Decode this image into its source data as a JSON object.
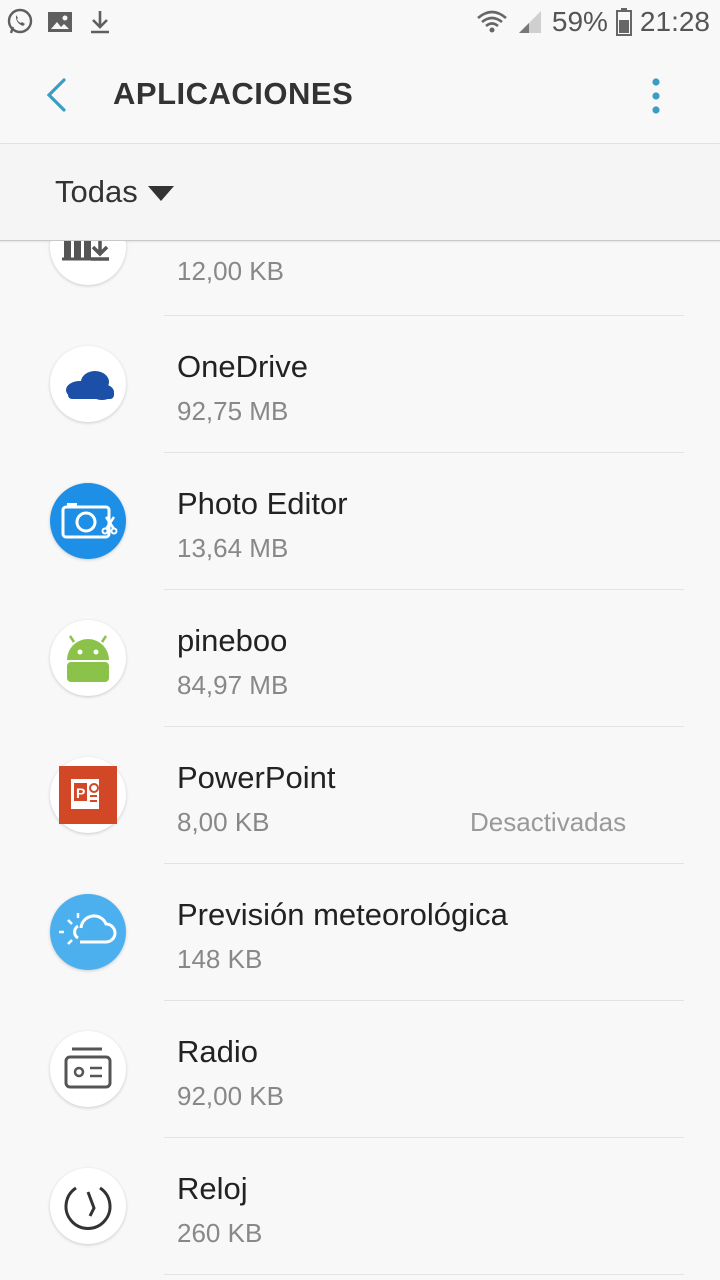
{
  "status_bar": {
    "battery_percent": "59%",
    "time": "21:28",
    "left_icons": [
      "whatsapp-icon",
      "image-icon",
      "download-icon"
    ],
    "right_icons": [
      "wifi-icon",
      "signal-icon",
      "battery-icon"
    ]
  },
  "app_bar": {
    "title": "APLICACIONES",
    "back_icon": "back-chevron-icon",
    "more_icon": "more-vert-icon",
    "accent_color": "#3b9cc4"
  },
  "filter": {
    "selected": "Todas"
  },
  "apps": [
    {
      "name": "",
      "size": "12,00 KB",
      "state": "",
      "icon": "download-manager-icon"
    },
    {
      "name": "OneDrive",
      "size": "92,75 MB",
      "state": "",
      "icon": "onedrive-icon"
    },
    {
      "name": "Photo Editor",
      "size": "13,64 MB",
      "state": "",
      "icon": "photo-editor-icon"
    },
    {
      "name": "pineboo",
      "size": "84,97 MB",
      "state": "",
      "icon": "android-icon"
    },
    {
      "name": "PowerPoint",
      "size": "8,00 KB",
      "state": "Desactivadas",
      "icon": "powerpoint-icon"
    },
    {
      "name": "Previsión meteorológica",
      "size": "148 KB",
      "state": "",
      "icon": "weather-icon"
    },
    {
      "name": "Radio",
      "size": "92,00 KB",
      "state": "",
      "icon": "radio-icon"
    },
    {
      "name": "Reloj",
      "size": "260 KB",
      "state": "",
      "icon": "clock-icon"
    }
  ]
}
